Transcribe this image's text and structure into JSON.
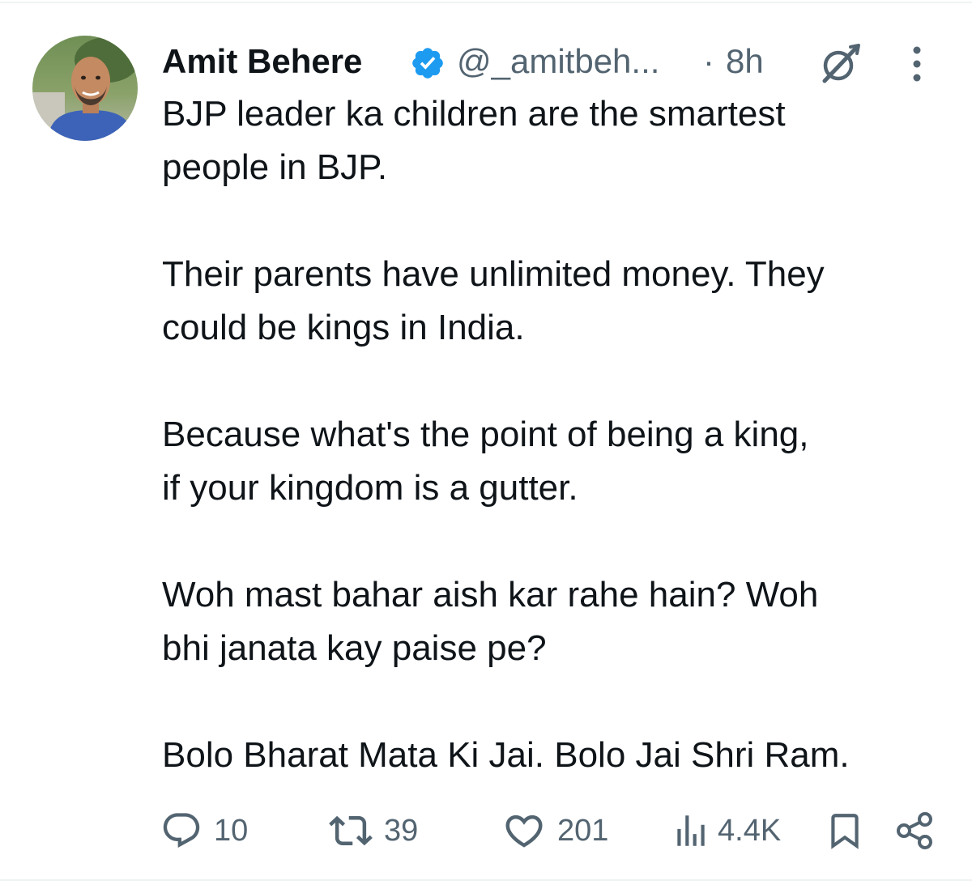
{
  "tweet": {
    "author": {
      "display_name": "Amit Behere",
      "handle": "@_amitbeh...",
      "verified": true,
      "avatar_icon": "profile-photo"
    },
    "separator": "·",
    "timestamp": "8h",
    "paragraphs": [
      "BJP leader ka children are the smartest\npeople in BJP.",
      "Their parents have unlimited money. They\ncould be kings in India.",
      "Because what's the point of being a king,\nif your kingdom is a gutter.",
      "Woh mast bahar aish kar rahe hain? Woh\nbhi janata kay paise pe?",
      "Bolo Bharat Mata Ki Jai. Bolo Jai Shri Ram."
    ],
    "actions": {
      "replies": "10",
      "reposts": "39",
      "likes": "201",
      "views": "4.4K"
    }
  },
  "colors": {
    "text": "#0f1419",
    "muted": "#536471",
    "verified": "#1d9bf0"
  },
  "icons": [
    "verified-badge-icon",
    "grok-icon",
    "more-icon",
    "reply-icon",
    "repost-icon",
    "like-icon",
    "views-icon",
    "bookmark-icon",
    "share-icon"
  ]
}
